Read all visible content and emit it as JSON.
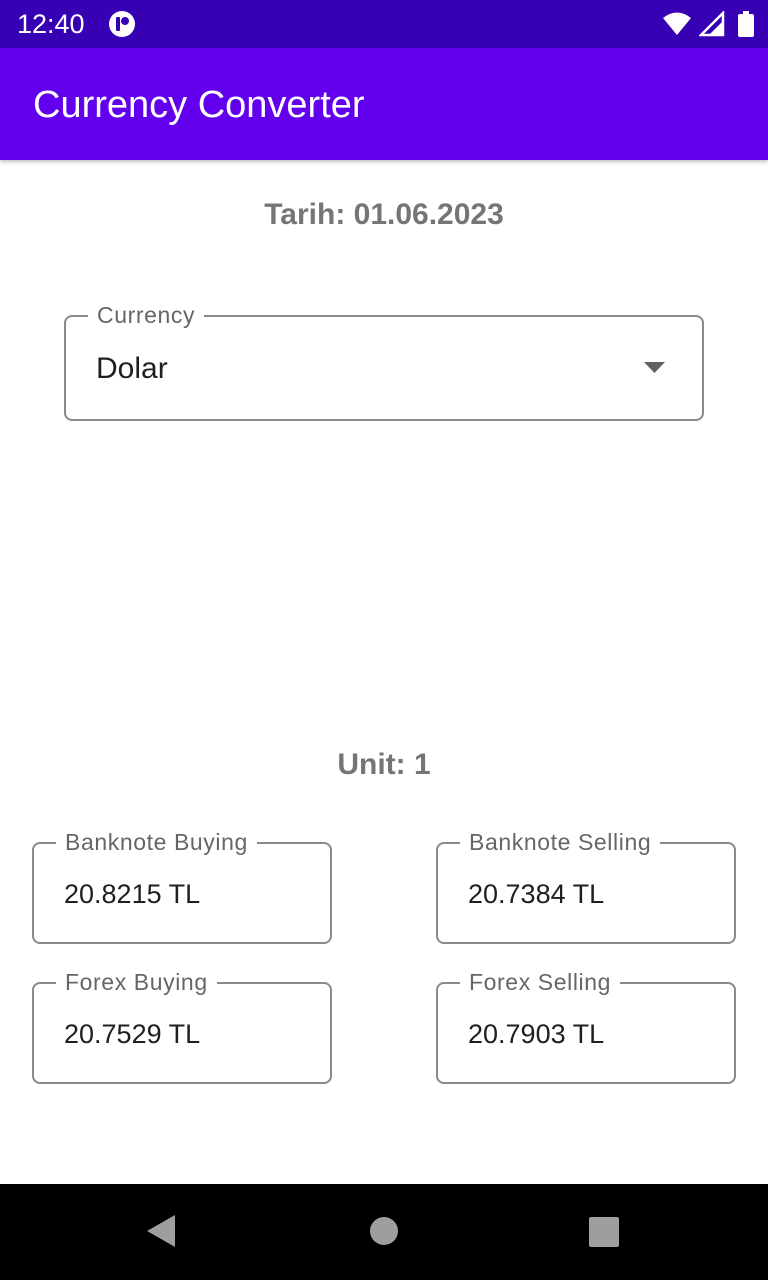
{
  "status_bar": {
    "time": "12:40"
  },
  "app_bar": {
    "title": "Currency Converter"
  },
  "date_text": "Tarih: 01.06.2023",
  "currency_dropdown": {
    "label": "Currency",
    "selected": "Dolar"
  },
  "unit_text": "Unit: 1",
  "rates": {
    "banknote_buying": {
      "label": "Banknote Buying",
      "value": "20.8215 TL"
    },
    "banknote_selling": {
      "label": "Banknote Selling",
      "value": "20.7384 TL"
    },
    "forex_buying": {
      "label": "Forex Buying",
      "value": "20.7529 TL"
    },
    "forex_selling": {
      "label": "Forex Selling",
      "value": "20.7903 TL"
    }
  },
  "icons": {
    "status_app": "app-notification-icon",
    "wifi": "wifi-icon",
    "signal": "cell-signal-icon",
    "battery": "battery-icon",
    "dropdown": "dropdown-arrow-icon",
    "back": "nav-back-icon",
    "home": "nav-home-icon",
    "recents": "nav-recents-icon"
  },
  "colors": {
    "status_bar": "#3700b3",
    "app_bar": "#6200ee",
    "muted_text": "#757575",
    "nav_bar": "#000000"
  }
}
